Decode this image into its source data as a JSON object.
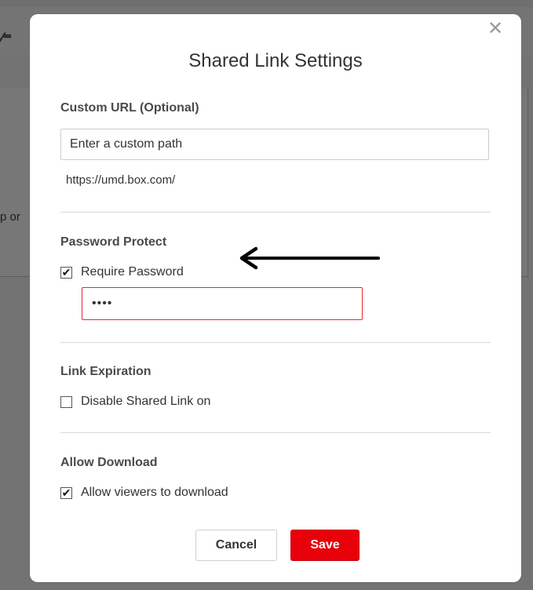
{
  "background": {
    "snippet_text": "p or",
    "toolbar_icon": "edit-icon"
  },
  "dialog": {
    "title": "Shared Link Settings",
    "close_symbol": "✕",
    "custom_url": {
      "label": "Custom URL (Optional)",
      "placeholder": "Enter a custom path",
      "prefix": "https://umd.box.com/"
    },
    "password_protect": {
      "label": "Password Protect",
      "checkbox_label": "Require Password",
      "checked": true,
      "password_value": "••••"
    },
    "link_expiration": {
      "label": "Link Expiration",
      "checkbox_label": "Disable Shared Link on",
      "checked": false
    },
    "allow_download": {
      "label": "Allow Download",
      "checkbox_label": "Allow viewers to download",
      "checked": true
    },
    "buttons": {
      "cancel_label": "Cancel",
      "save_label": "Save"
    },
    "check_mark": "✔"
  },
  "colors": {
    "save_button": "#e8000b",
    "password_border": "#e5282e",
    "backdrop": "#6f6f6f"
  }
}
